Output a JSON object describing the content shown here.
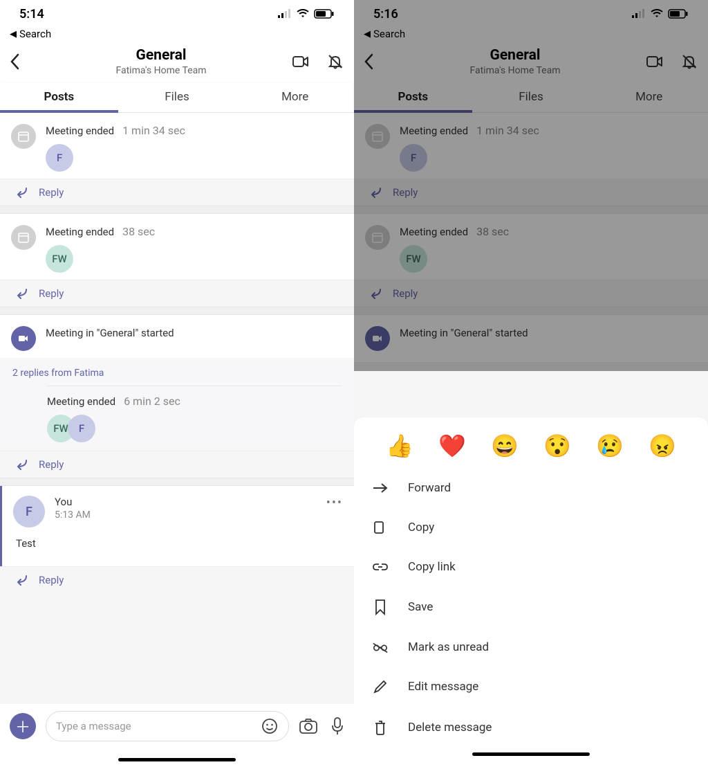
{
  "left": {
    "status_time": "5:14",
    "back_search": "Search",
    "header": {
      "title": "General",
      "subtitle": "Fatima's Home Team"
    },
    "tabs": {
      "posts": "Posts",
      "files": "Files",
      "more": "More"
    },
    "posts": {
      "m1": {
        "title": "Meeting ended",
        "dur": "1 min 34 sec",
        "av1": "F"
      },
      "m2": {
        "title": "Meeting ended",
        "dur": "38 sec",
        "av1": "FW"
      },
      "m3": {
        "title": "Meeting in \"General\"  started"
      },
      "replies_hint": "2 replies from Fatima",
      "m4": {
        "title": "Meeting ended",
        "dur": "6 min 2 sec",
        "av1": "FW",
        "av2": "F"
      },
      "msg": {
        "author": "You",
        "time": "5:13 AM",
        "body": "Test",
        "av": "F"
      }
    },
    "reply_label": "Reply",
    "composer_placeholder": "Type a message"
  },
  "right": {
    "status_time": "5:16",
    "back_search": "Search",
    "header": {
      "title": "General",
      "subtitle": "Fatima's Home Team"
    },
    "tabs": {
      "posts": "Posts",
      "files": "Files",
      "more": "More"
    },
    "posts": {
      "m1": {
        "title": "Meeting ended",
        "dur": "1 min 34 sec",
        "av1": "F"
      },
      "m2": {
        "title": "Meeting ended",
        "dur": "38 sec",
        "av1": "FW"
      },
      "m3": {
        "title": "Meeting in \"General\"  started"
      }
    },
    "reply_label": "Reply",
    "sheet": {
      "reactions": {
        "r0": "👍",
        "r1": "❤️",
        "r2": "😄",
        "r3": "😯",
        "r4": "😢",
        "r5": "😠"
      },
      "items": {
        "forward": "Forward",
        "copy": "Copy",
        "copylink": "Copy link",
        "save": "Save",
        "unread": "Mark as unread",
        "edit": "Edit message",
        "delete": "Delete message"
      }
    }
  }
}
